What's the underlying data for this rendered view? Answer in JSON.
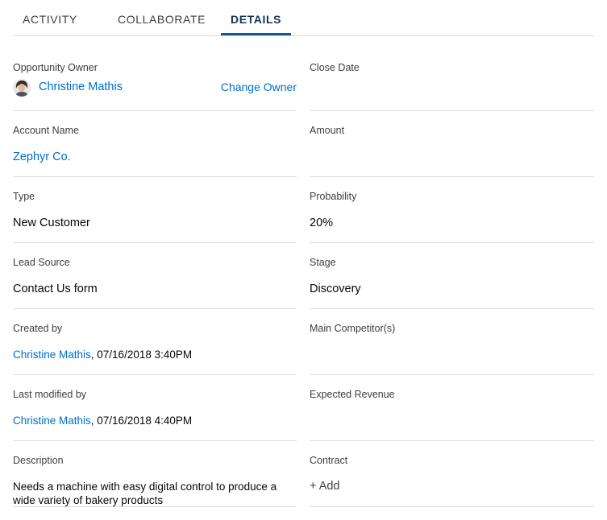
{
  "tabs": [
    {
      "label": "ACTIVITY"
    },
    {
      "label": "COLLABORATE"
    },
    {
      "label": "DETAILS"
    }
  ],
  "active_tab": "DETAILS",
  "details": {
    "opportunity_owner": {
      "label": "Opportunity Owner",
      "name": "Christine Mathis",
      "action": "Change Owner"
    },
    "close_date": {
      "label": "Close Date",
      "value": ""
    },
    "account_name": {
      "label": "Account Name",
      "value": "Zephyr Co."
    },
    "amount": {
      "label": "Amount",
      "value": ""
    },
    "type": {
      "label": "Type",
      "value": "New Customer"
    },
    "probability": {
      "label": "Probability",
      "value": "20%"
    },
    "lead_source": {
      "label": "Lead Source",
      "value": "Contact Us form"
    },
    "stage": {
      "label": "Stage",
      "value": "Discovery"
    },
    "created_by": {
      "label": "Created by",
      "name": "Christine Mathis",
      "timestamp": ", 07/16/2018 3:40PM"
    },
    "main_competitors": {
      "label": "Main Competitor(s)",
      "value": ""
    },
    "last_modified_by": {
      "label": "Last modified by",
      "name": "Christine Mathis",
      "timestamp": ", 07/16/2018 4:40PM"
    },
    "expected_revenue": {
      "label": "Expected Revenue",
      "value": ""
    },
    "description": {
      "label": "Description",
      "value": "Needs a machine with easy digital control to produce a wide variety of bakery products"
    },
    "contract": {
      "label": "Contract",
      "action": "+ Add"
    }
  },
  "colors": {
    "link": "#006dcc",
    "active_tab": "#16325c",
    "tab_indicator": "#1b5297",
    "divider": "#dddbda"
  }
}
